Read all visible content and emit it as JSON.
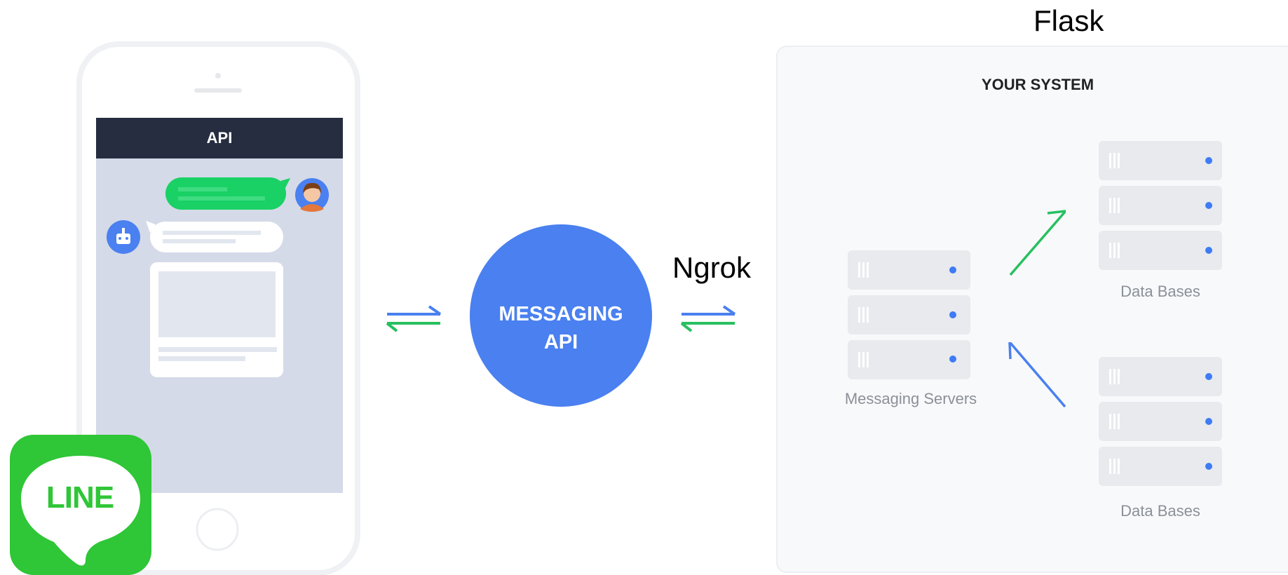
{
  "labels": {
    "flask": "Flask",
    "ngrok": "Ngrok",
    "phone_header": "API",
    "messaging_api": [
      "MESSAGING",
      "API"
    ],
    "your_system": "YOUR SYSTEM",
    "messaging_servers": "Messaging Servers",
    "data_bases_top": "Data Bases",
    "data_bases_bottom": "Data Bases",
    "line_logo": "LINE"
  },
  "icons": {
    "user_avatar": "person-avatar-icon",
    "bot_avatar": "robot-icon",
    "server": "server-rack-icon",
    "exchange_arrows": "bidirectional-arrows-icon"
  },
  "colors": {
    "phone_header": "#262d40",
    "chat_bg": "#d4dae8",
    "green_bubble": "#19d165",
    "api_circle": "#4a80f0",
    "arrow_blue": "#4a80f0",
    "arrow_green": "#28c060",
    "server_block": "#e8eaee",
    "server_dot": "#3e7bf5",
    "line_green": "#2fc637",
    "system_panel": "#f8f9fb"
  }
}
